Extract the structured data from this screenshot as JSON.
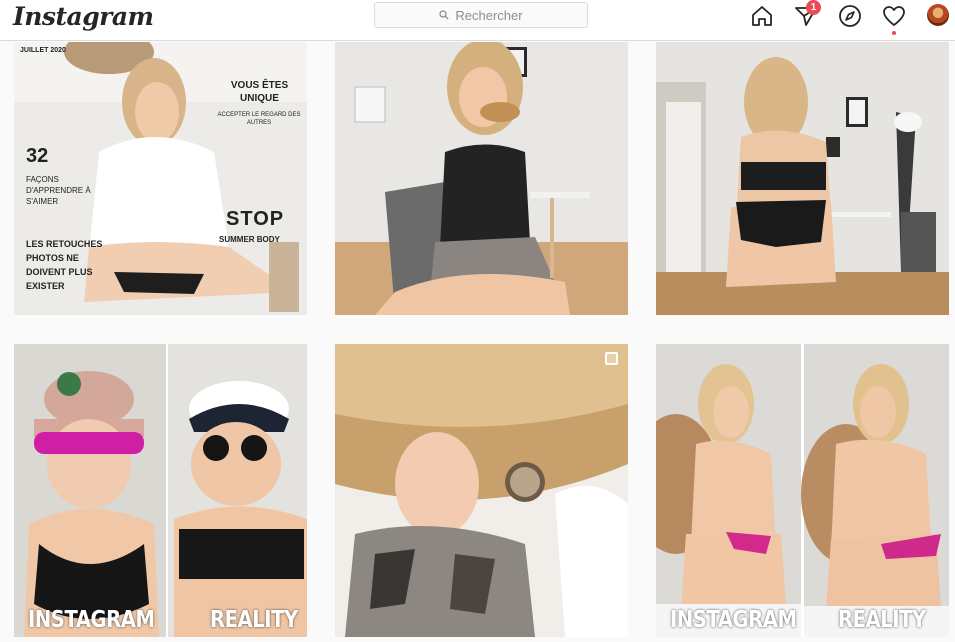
{
  "header": {
    "logo": "Instagram",
    "search_placeholder": "Rechercher",
    "icons": [
      "home-icon",
      "direct-icon",
      "explore-icon",
      "heart-icon"
    ],
    "direct_badge": "1",
    "accent": "#ed4956"
  },
  "posts": [
    {
      "kind": "magazine-cover",
      "date": "JUILLET 2020",
      "headline": "VOUS ÊTES UNIQUE",
      "subline": "ACCEPTER LE REGARD DES AUTRES",
      "number": "32",
      "number_text": "FAÇONS D'APPRENDRE À S'AIMER",
      "stop": "STOP",
      "summer": "SUMMER BODY",
      "retouches": "LES RETOUCHES PHOTOS NE DOIVENT PLUS EXISTER"
    },
    {
      "kind": "photo-eating"
    },
    {
      "kind": "photo-back"
    },
    {
      "kind": "comparison",
      "left_label": "INSTAGRAM",
      "right_label": "REALITY"
    },
    {
      "kind": "photo-lying",
      "multi": true
    },
    {
      "kind": "comparison",
      "left_label": "INSTAGRAM",
      "right_label": "REALITY"
    }
  ]
}
